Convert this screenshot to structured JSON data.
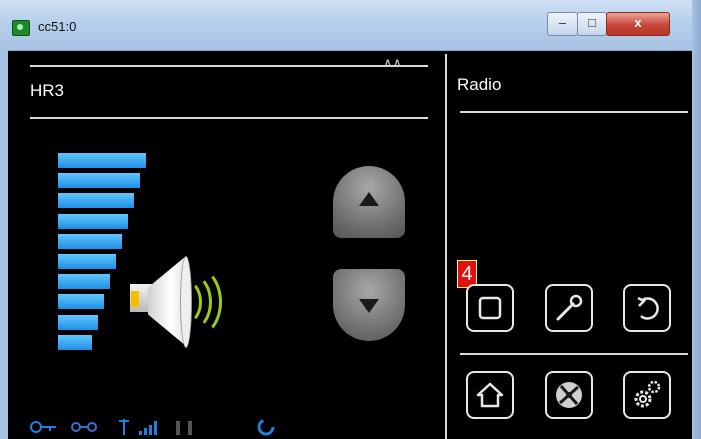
{
  "window": {
    "title": "cc51:0",
    "buttons": {
      "minimize": "–",
      "maximize": "□",
      "close": "x"
    }
  },
  "left_panel": {
    "title": "HR3",
    "volume_level": 1.0,
    "volume_bars": 10
  },
  "right_panel": {
    "title": "Radio",
    "badge": "4"
  },
  "icons": {
    "row1": [
      "stop-icon",
      "wrench-icon",
      "back-icon"
    ],
    "row2": [
      "home-icon",
      "fan-icon",
      "settings-icon"
    ],
    "status": [
      "key-icon",
      "link-icon",
      "antenna-icon",
      "signal-icon",
      "phone-icon",
      "refresh-icon"
    ]
  },
  "colors": {
    "accent": "#1f8fe6",
    "wave": "#9ccc1a",
    "badge": "#e01010"
  }
}
